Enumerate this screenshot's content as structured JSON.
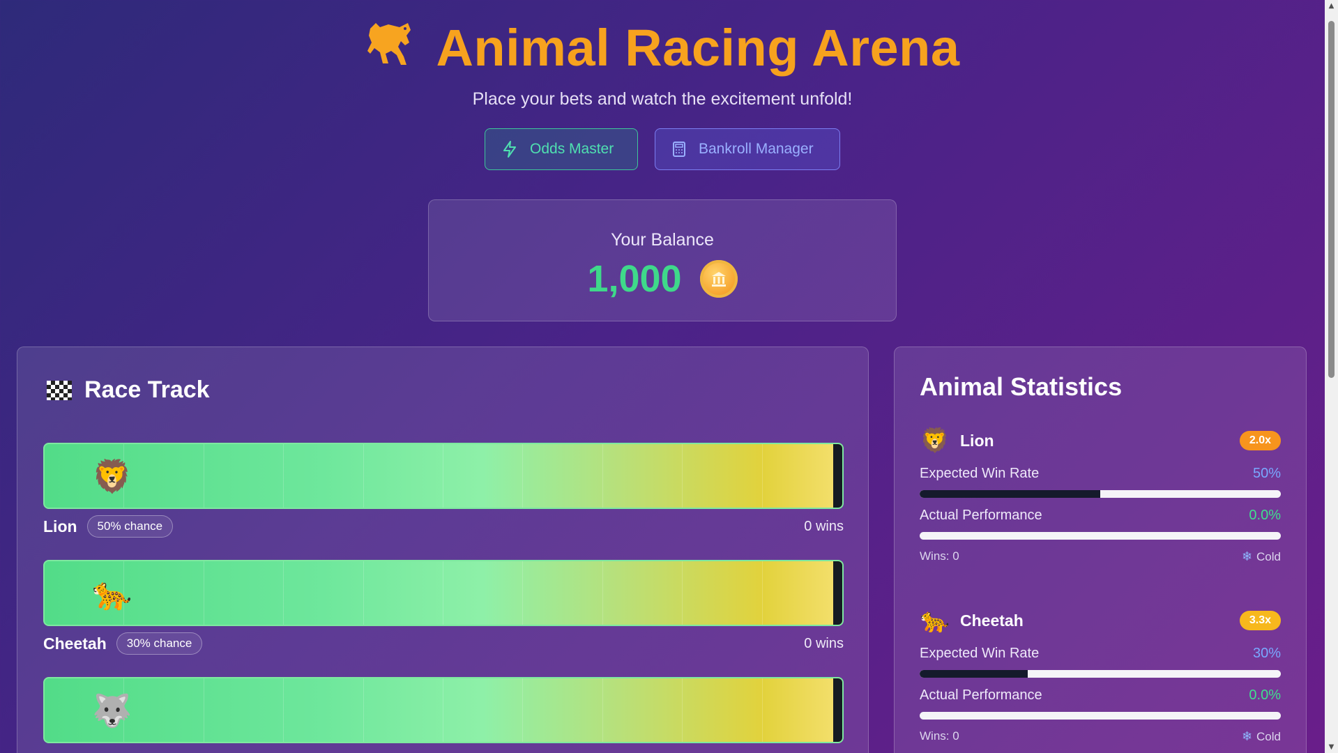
{
  "header": {
    "title": "Animal Racing Arena",
    "title_icon": "horse-icon",
    "subtitle": "Place your bets and watch the excitement unfold!"
  },
  "buttons": {
    "odds_master": "Odds Master",
    "bankroll_manager": "Bankroll Manager"
  },
  "balance": {
    "label": "Your Balance",
    "value": "1,000",
    "coin_icon": "coin-icon"
  },
  "race_track": {
    "title": "Race Track",
    "lanes": [
      {
        "name": "Lion",
        "emoji": "🦁",
        "chance": "50% chance",
        "wins": "0 wins"
      },
      {
        "name": "Cheetah",
        "emoji": "🐆",
        "chance": "30% chance",
        "wins": "0 wins"
      },
      {
        "name": "Wolf",
        "emoji": "🐺",
        "chance": "",
        "wins": ""
      }
    ]
  },
  "stats": {
    "title": "Animal Statistics",
    "expected_label": "Expected Win Rate",
    "actual_label": "Actual Performance",
    "animals": [
      {
        "name": "Lion",
        "emoji": "🦁",
        "odds": "2.0x",
        "odds_color": "#f7941d",
        "expected": "50%",
        "expected_fraction": 0.5,
        "actual": "0.0%",
        "actual_fraction": 0.0,
        "wins": "Wins: 0",
        "status": "Cold"
      },
      {
        "name": "Cheetah",
        "emoji": "🐆",
        "odds": "3.3x",
        "odds_color": "#f7b81d",
        "expected": "30%",
        "expected_fraction": 0.3,
        "actual": "0.0%",
        "actual_fraction": 0.0,
        "wins": "Wins: 0",
        "status": "Cold"
      }
    ]
  },
  "colors": {
    "title": "#f7a21e",
    "balance": "#3fd98a",
    "odds_button": "#4fe0b0",
    "bankroll_button": "#9ab0ff"
  }
}
